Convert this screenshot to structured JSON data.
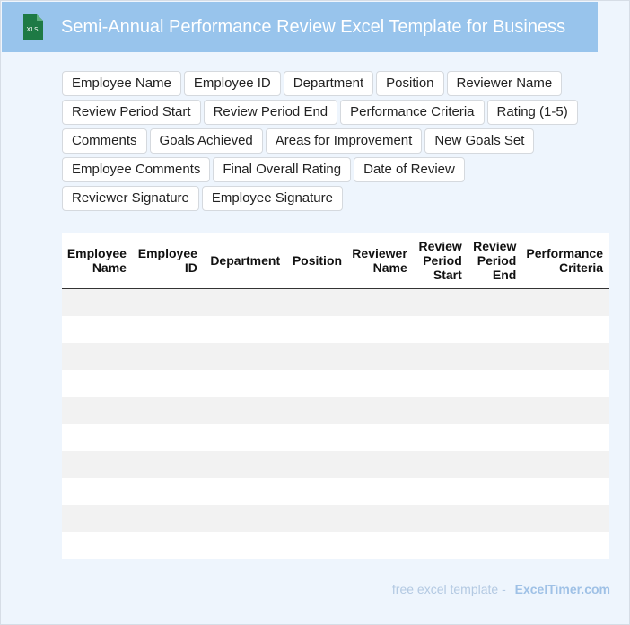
{
  "header": {
    "icon": "excel-file-icon",
    "icon_label": "XLS",
    "title": "Semi-Annual Performance Review Excel Template for Business"
  },
  "tags": [
    "Employee Name",
    "Employee ID",
    "Department",
    "Position",
    "Reviewer Name",
    "Review Period Start",
    "Review Period End",
    "Performance Criteria",
    "Rating (1-5)",
    "Comments",
    "Goals Achieved",
    "Areas for Improvement",
    "New Goals Set",
    "Employee Comments",
    "Final Overall Rating",
    "Date of Review",
    "Reviewer Signature",
    "Employee Signature"
  ],
  "table": {
    "columns": [
      "Employee Name",
      "Employee ID",
      "Department",
      "Position",
      "Reviewer Name",
      "Review Period Start",
      "Review Period End",
      "Performance Criteria"
    ],
    "empty_rows": 10
  },
  "footer": {
    "text": "free excel template -",
    "brand": "ExcelTimer.com"
  },
  "colors": {
    "header_bg": "#98c4ec",
    "page_bg": "#eef5fd",
    "excel_green": "#1e7a45"
  }
}
